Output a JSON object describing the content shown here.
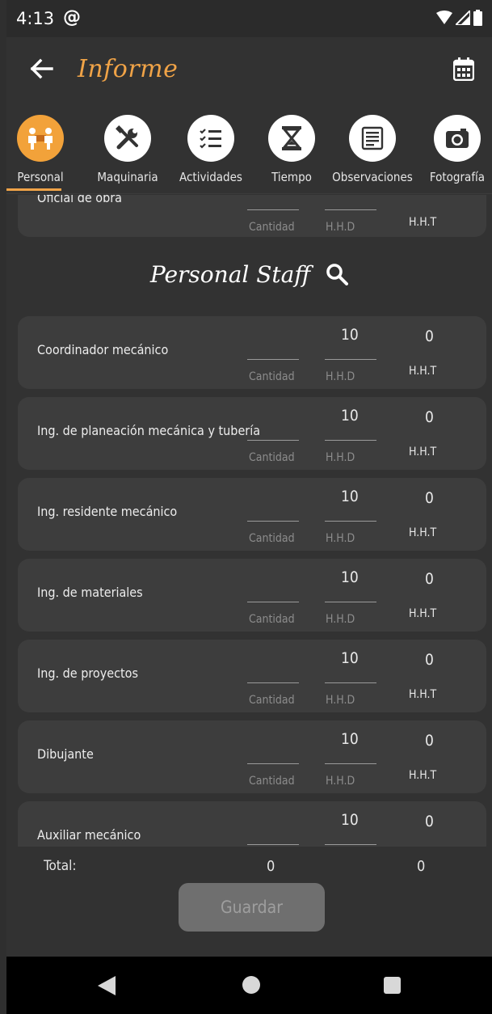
{
  "status_bar": {
    "time": "4:13",
    "at_symbol": "@"
  },
  "app_bar": {
    "title": "Informe"
  },
  "tabs": [
    {
      "label": "Personal",
      "icon": "workers-icon",
      "active": true
    },
    {
      "label": "Maquinaria",
      "icon": "tools-icon",
      "active": false
    },
    {
      "label": "Actividades",
      "icon": "checklist-icon",
      "active": false
    },
    {
      "label": "Tiempo",
      "icon": "hourglass-icon",
      "active": false
    },
    {
      "label": "Observaciones",
      "icon": "document-icon",
      "active": false
    },
    {
      "label": "Fotografía",
      "icon": "camera-icon",
      "active": false
    }
  ],
  "partial_card": {
    "label": "Oficial de obra",
    "cantidad_hint": "Cantidad",
    "hhd_hint": "H.H.D",
    "hht_label": "H.H.T"
  },
  "section": {
    "title": "Personal Staff"
  },
  "hints": {
    "cantidad": "Cantidad",
    "hhd": "H.H.D",
    "hht": "H.H.T"
  },
  "staff": [
    {
      "label": "Coordinador mecánico",
      "hhd": "10",
      "hht": "0"
    },
    {
      "label": "Ing. de planeación mecánica y tubería",
      "hhd": "10",
      "hht": "0"
    },
    {
      "label": "Ing. residente mecánico",
      "hhd": "10",
      "hht": "0"
    },
    {
      "label": "Ing. de materiales",
      "hhd": "10",
      "hht": "0"
    },
    {
      "label": "Ing. de proyectos",
      "hhd": "10",
      "hht": "0"
    },
    {
      "label": "Dibujante",
      "hhd": "10",
      "hht": "0"
    },
    {
      "label": "Auxiliar mecánico",
      "hhd": "10",
      "hht": "0"
    }
  ],
  "totals": {
    "label": "Total:",
    "value_a": "0",
    "value_b": "0"
  },
  "save_button": {
    "label": "Guardar"
  },
  "colors": {
    "accent": "#f0a347",
    "background": "#323232",
    "card": "#3d3d3d"
  }
}
